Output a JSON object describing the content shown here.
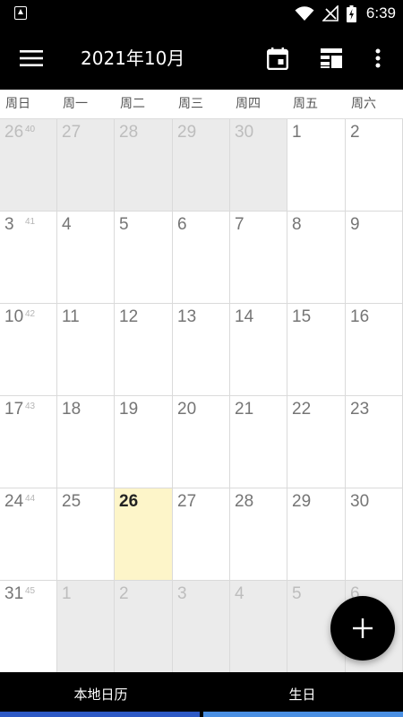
{
  "status_bar": {
    "time": "6:39",
    "icons": [
      "app-notification-icon",
      "wifi-icon",
      "no-signal-icon",
      "battery-charging-icon"
    ]
  },
  "app_bar": {
    "title": "2021年10月",
    "menu_icon": "menu-icon",
    "today_icon": "calendar-today-icon",
    "view_icon": "view-layout-icon",
    "more_icon": "more-vert-icon"
  },
  "weekdays": [
    "周日",
    "周一",
    "周二",
    "周三",
    "周四",
    "周五",
    "周六"
  ],
  "weeks": [
    {
      "week_no": "40",
      "days": [
        {
          "d": "26",
          "other": true
        },
        {
          "d": "27",
          "other": true
        },
        {
          "d": "28",
          "other": true
        },
        {
          "d": "29",
          "other": true
        },
        {
          "d": "30",
          "other": true
        },
        {
          "d": "1"
        },
        {
          "d": "2"
        }
      ]
    },
    {
      "week_no": "41",
      "days": [
        {
          "d": "3"
        },
        {
          "d": "4"
        },
        {
          "d": "5"
        },
        {
          "d": "6"
        },
        {
          "d": "7"
        },
        {
          "d": "8"
        },
        {
          "d": "9"
        }
      ]
    },
    {
      "week_no": "42",
      "days": [
        {
          "d": "10"
        },
        {
          "d": "11"
        },
        {
          "d": "12"
        },
        {
          "d": "13"
        },
        {
          "d": "14"
        },
        {
          "d": "15"
        },
        {
          "d": "16"
        }
      ]
    },
    {
      "week_no": "43",
      "days": [
        {
          "d": "17"
        },
        {
          "d": "18"
        },
        {
          "d": "19"
        },
        {
          "d": "20"
        },
        {
          "d": "21"
        },
        {
          "d": "22"
        },
        {
          "d": "23"
        }
      ]
    },
    {
      "week_no": "44",
      "days": [
        {
          "d": "24"
        },
        {
          "d": "25"
        },
        {
          "d": "26",
          "today": true
        },
        {
          "d": "27"
        },
        {
          "d": "28"
        },
        {
          "d": "29"
        },
        {
          "d": "30"
        }
      ]
    },
    {
      "week_no": "45",
      "days": [
        {
          "d": "31"
        },
        {
          "d": "1",
          "other": true
        },
        {
          "d": "2",
          "other": true
        },
        {
          "d": "3",
          "other": true
        },
        {
          "d": "4",
          "other": true
        },
        {
          "d": "5",
          "other": true
        },
        {
          "d": "6",
          "other": true
        }
      ]
    }
  ],
  "fab": {
    "icon": "add-icon"
  },
  "tabs": [
    {
      "label": "本地日历",
      "color": "#2d59c5"
    },
    {
      "label": "生日",
      "color": "#4a8fe2"
    }
  ],
  "colors": {
    "bar_background": "#000000",
    "today_highlight": "#fdf5c9",
    "other_month_background": "#ebebeb"
  }
}
